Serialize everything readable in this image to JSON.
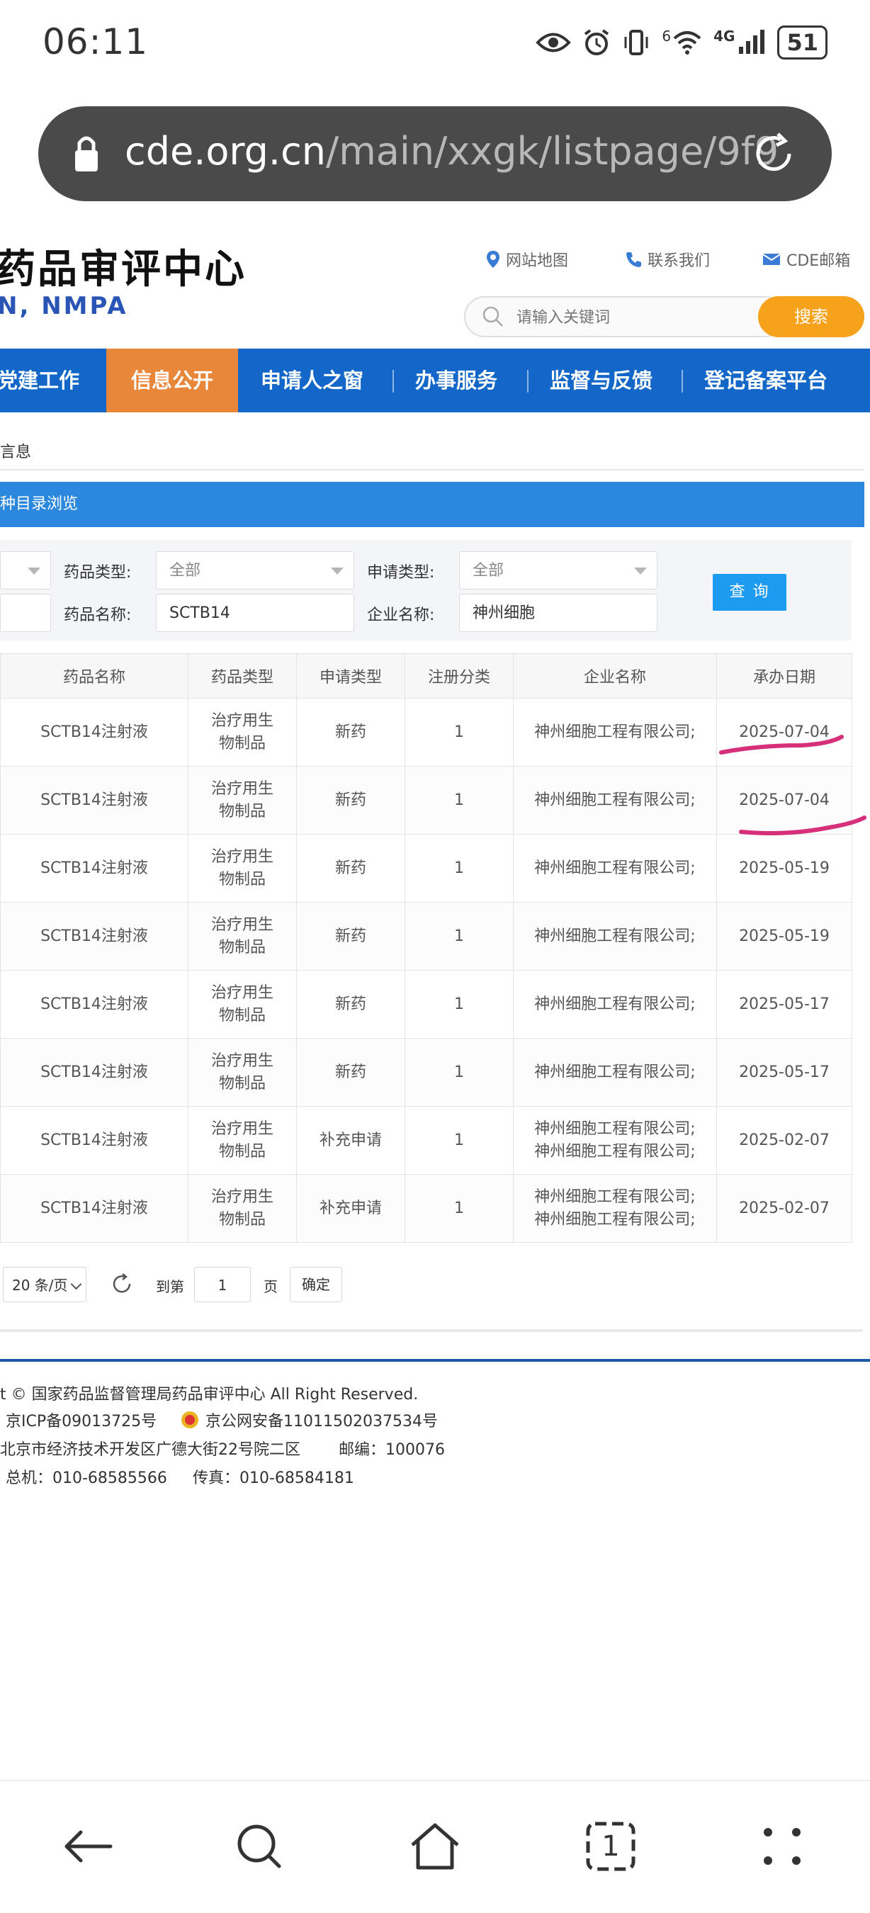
{
  "status_bar": {
    "time": "06:11",
    "network_sup": "6",
    "network": "4G",
    "battery": "51"
  },
  "browser": {
    "url_host": "cde.org.cn",
    "url_path": "/main/xxgk/listpage/9f9"
  },
  "site": {
    "title": "药品审评中心",
    "subtitle": "N, NMPA",
    "top_links": [
      "网站地图",
      "联系我们",
      "CDE邮箱"
    ],
    "search_placeholder": "请输入关键词",
    "search_button": "搜索"
  },
  "nav": {
    "items": [
      "党建工作",
      "信息公开",
      "申请人之窗",
      "办事服务",
      "监督与反馈",
      "登记备案平台"
    ],
    "active": "信息公开"
  },
  "breadcrumb": "言息",
  "section_title": "种目录浏览",
  "filters": {
    "drug_type_label": "药品类型:",
    "drug_type_value": "全部",
    "apply_type_label": "申请类型:",
    "apply_type_value": "全部",
    "drug_name_label": "药品名称:",
    "drug_name_value": "SCTB14",
    "company_label": "企业名称:",
    "company_value": "神州细胞",
    "query_button": "查 询"
  },
  "table": {
    "headers": [
      "药品名称",
      "药品类型",
      "申请类型",
      "注册分类",
      "企业名称",
      "承办日期"
    ],
    "rows": [
      {
        "name": "SCTB14注射液",
        "type1": "治疗用生",
        "type2": "物制品",
        "apply": "新药",
        "reg": "1",
        "company1": "神州细胞工程有限公司;",
        "company2": "",
        "date": "2025-07-04"
      },
      {
        "name": "SCTB14注射液",
        "type1": "治疗用生",
        "type2": "物制品",
        "apply": "新药",
        "reg": "1",
        "company1": "神州细胞工程有限公司;",
        "company2": "",
        "date": "2025-07-04"
      },
      {
        "name": "SCTB14注射液",
        "type1": "治疗用生",
        "type2": "物制品",
        "apply": "新药",
        "reg": "1",
        "company1": "神州细胞工程有限公司;",
        "company2": "",
        "date": "2025-05-19"
      },
      {
        "name": "SCTB14注射液",
        "type1": "治疗用生",
        "type2": "物制品",
        "apply": "新药",
        "reg": "1",
        "company1": "神州细胞工程有限公司;",
        "company2": "",
        "date": "2025-05-19"
      },
      {
        "name": "SCTB14注射液",
        "type1": "治疗用生",
        "type2": "物制品",
        "apply": "新药",
        "reg": "1",
        "company1": "神州细胞工程有限公司;",
        "company2": "",
        "date": "2025-05-17"
      },
      {
        "name": "SCTB14注射液",
        "type1": "治疗用生",
        "type2": "物制品",
        "apply": "新药",
        "reg": "1",
        "company1": "神州细胞工程有限公司;",
        "company2": "",
        "date": "2025-05-17"
      },
      {
        "name": "SCTB14注射液",
        "type1": "治疗用生",
        "type2": "物制品",
        "apply": "补充申请",
        "reg": "1",
        "company1": "神州细胞工程有限公司;",
        "company2": "神州细胞工程有限公司;",
        "date": "2025-02-07"
      },
      {
        "name": "SCTB14注射液",
        "type1": "治疗用生",
        "type2": "物制品",
        "apply": "补充申请",
        "reg": "1",
        "company1": "神州细胞工程有限公司;",
        "company2": "神州细胞工程有限公司;",
        "date": "2025-02-07"
      }
    ]
  },
  "pagination": {
    "page_size": "20 条/页",
    "goto_label": "到第",
    "page_value": "1",
    "page_suffix": "页",
    "confirm": "确定"
  },
  "footer": {
    "copyright": "t © 国家药品监督管理局药品审评中心   All Right Reserved.",
    "icp": "京ICP备09013725号",
    "police": "京公网安备11011502037534号",
    "address": "北京市经济技术开发区广德大街22号院二区",
    "postcode": "邮编：100076",
    "phone": "总机：010-68585566",
    "fax": "传真：010-68584181"
  },
  "colors": {
    "nav_blue": "#1267c8",
    "nav_active": "#e8863a",
    "search_btn": "#f7a21b",
    "section_bar": "#2b88dd",
    "query_btn": "#1d9bf0",
    "annotation": "#d6307a"
  },
  "bottom_nav": {
    "tab_count": "1",
    "icons": [
      "back-arrow-icon",
      "search-icon",
      "home-icon",
      "tabs-icon",
      "more-icon"
    ]
  }
}
